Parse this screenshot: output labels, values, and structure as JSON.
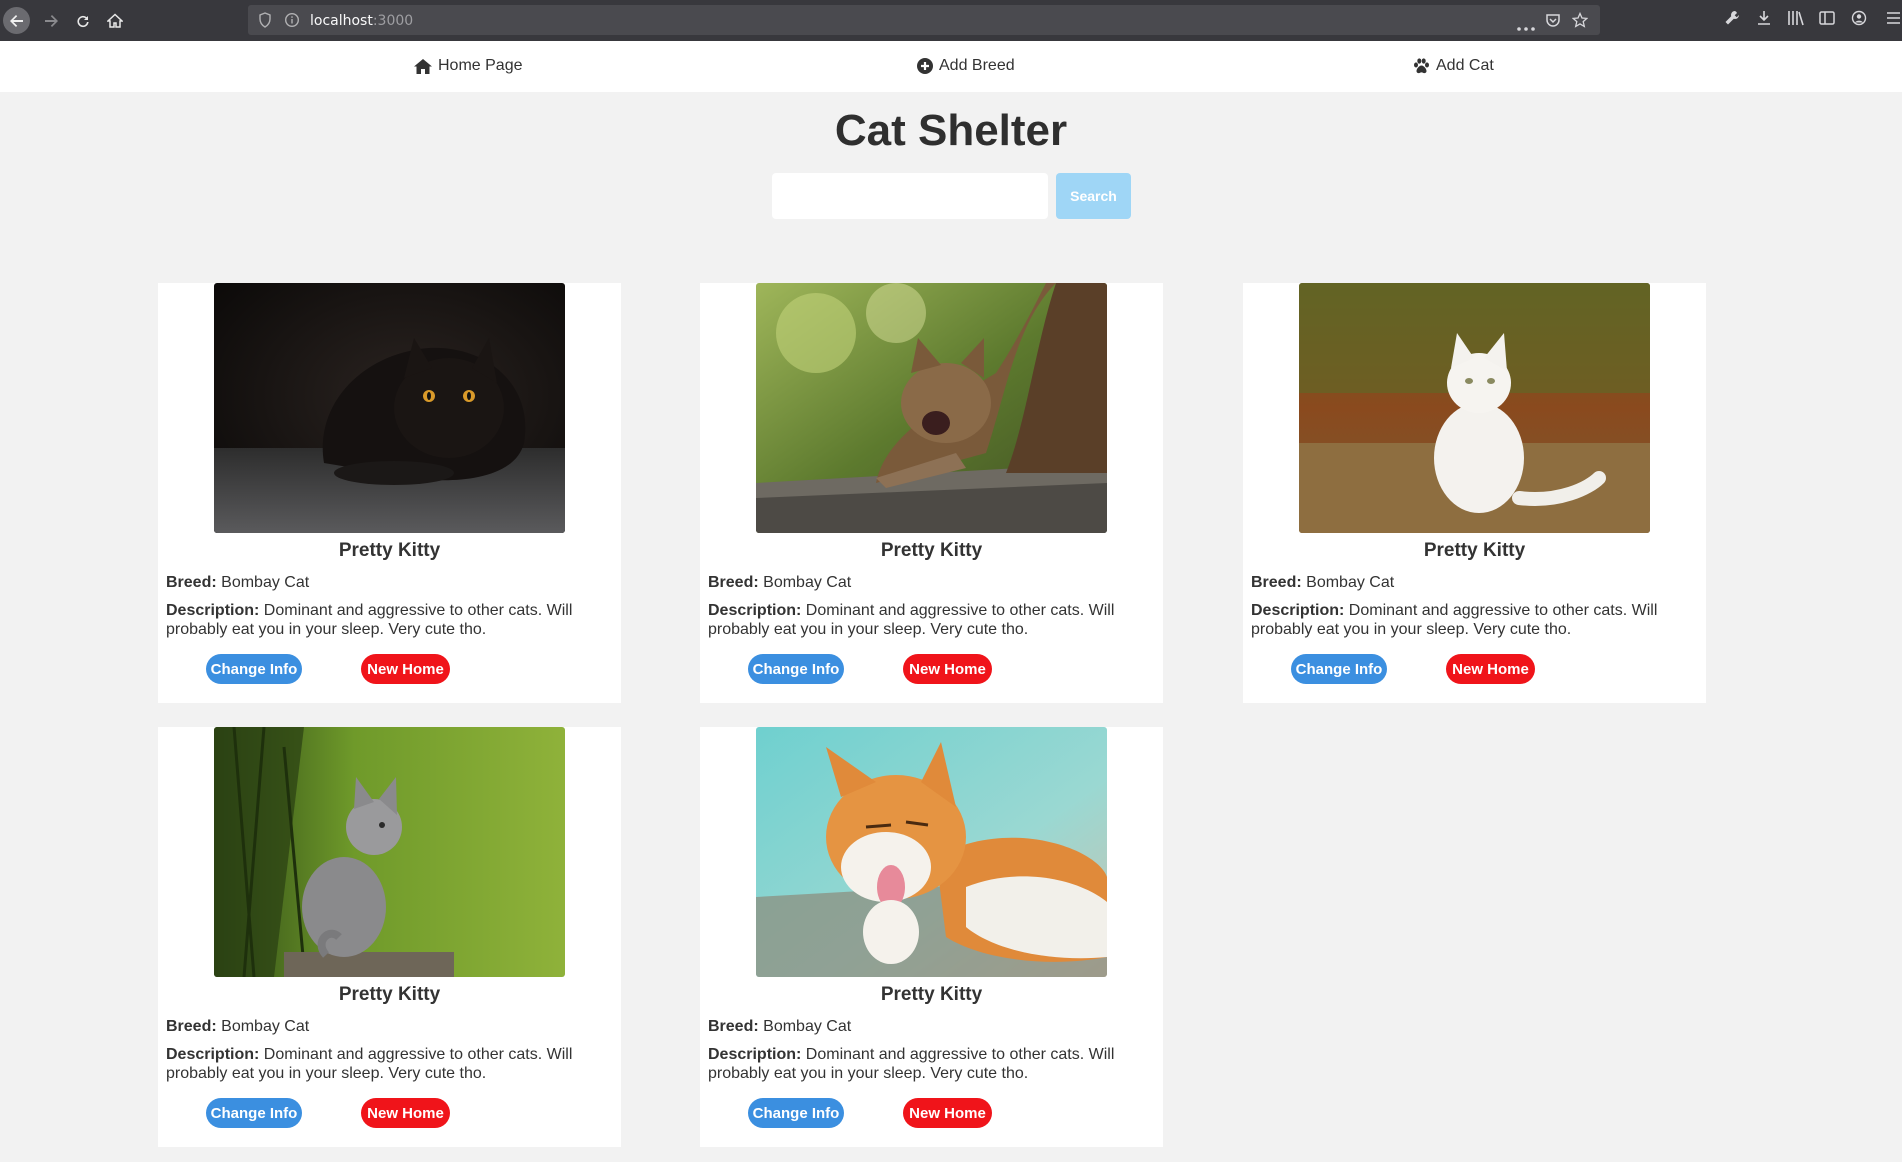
{
  "browser": {
    "url_host": "localhost",
    "url_port": ":3000"
  },
  "nav": {
    "home": "Home Page",
    "add_breed": "Add Breed",
    "add_cat": "Add Cat"
  },
  "header": {
    "title": "Cat Shelter",
    "search_placeholder": "",
    "search_label": "Search"
  },
  "labels": {
    "breed": "Breed:",
    "description": "Description:",
    "change_info": "Change Info",
    "new_home": "New Home"
  },
  "cats": [
    {
      "name": "Pretty Kitty",
      "breed": "Bombay Cat",
      "description": "Dominant and aggressive to other cats. Will probably eat you in your sleep. Very cute tho.",
      "photo": "black-cat-photo"
    },
    {
      "name": "Pretty Kitty",
      "breed": "Bombay Cat",
      "description": "Dominant and aggressive to other cats. Will probably eat you in your sleep. Very cute tho.",
      "photo": "tabby-cat-stretching-photo"
    },
    {
      "name": "Pretty Kitty",
      "breed": "Bombay Cat",
      "description": "Dominant and aggressive to other cats. Will probably eat you in your sleep. Very cute tho.",
      "photo": "white-cat-photo"
    },
    {
      "name": "Pretty Kitty",
      "breed": "Bombay Cat",
      "description": "Dominant and aggressive to other cats. Will probably eat you in your sleep. Very cute tho.",
      "photo": "grey-kitten-photo"
    },
    {
      "name": "Pretty Kitty",
      "breed": "Bombay Cat",
      "description": "Dominant and aggressive to other cats. Will probably eat you in your sleep. Very cute tho.",
      "photo": "orange-cat-licking-photo"
    }
  ],
  "colors": {
    "change_info": "#3b8fe0",
    "new_home": "#f0141a",
    "search_button": "#9fd6f6"
  }
}
